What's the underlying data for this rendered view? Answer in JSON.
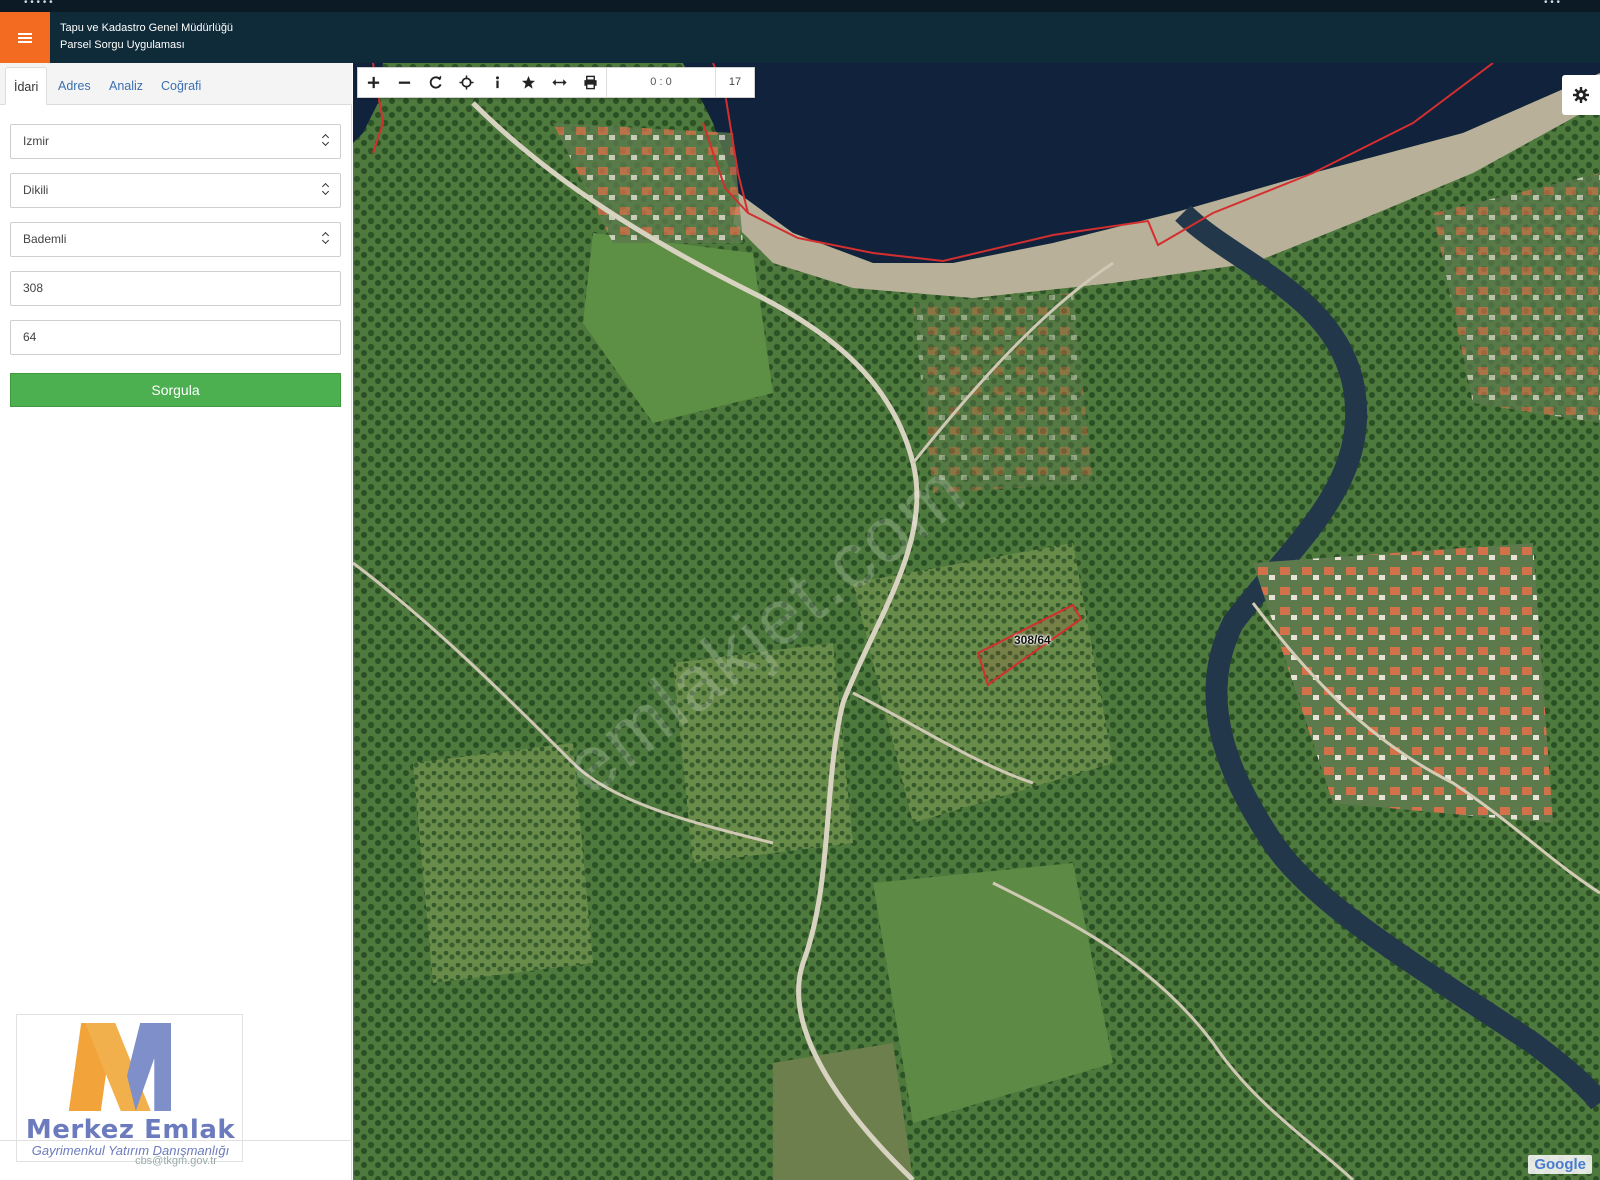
{
  "app": {
    "header_line1": "Tapu ve Kadastro Genel Müdürlüğü",
    "header_line2": "Parsel Sorgu Uygulaması",
    "status_left": "• • • • •",
    "status_right": "• • •"
  },
  "tabs": [
    {
      "label": "İdari",
      "active": true
    },
    {
      "label": "Adres",
      "active": false
    },
    {
      "label": "Analiz",
      "active": false
    },
    {
      "label": "Coğrafi",
      "active": false
    }
  ],
  "form": {
    "province": "Izmir",
    "district": "Dikili",
    "neighborhood": "Bademli",
    "block": "308",
    "parcel": "64",
    "submit_label": "Sorgula"
  },
  "logo": {
    "brand": "Merkez Emlak",
    "tagline": "Gayrimenkul Yatırım Danışmanlığı"
  },
  "footer": {
    "email": "cbs@tkgm.gov.tr"
  },
  "map": {
    "coordinates": "0 : 0",
    "zoom_level": "17",
    "parcel_label": "308/64",
    "watermark": "emlakjet.com",
    "attribution": "Google",
    "boundary_color": "#d32f2f"
  },
  "icons": {
    "toolbar": [
      "zoom-in-icon",
      "zoom-out-icon",
      "refresh-icon",
      "locate-icon",
      "info-icon",
      "favorite-icon",
      "measure-icon",
      "print-icon"
    ],
    "settings": "gear-icon",
    "menu": "hamburger-icon"
  }
}
